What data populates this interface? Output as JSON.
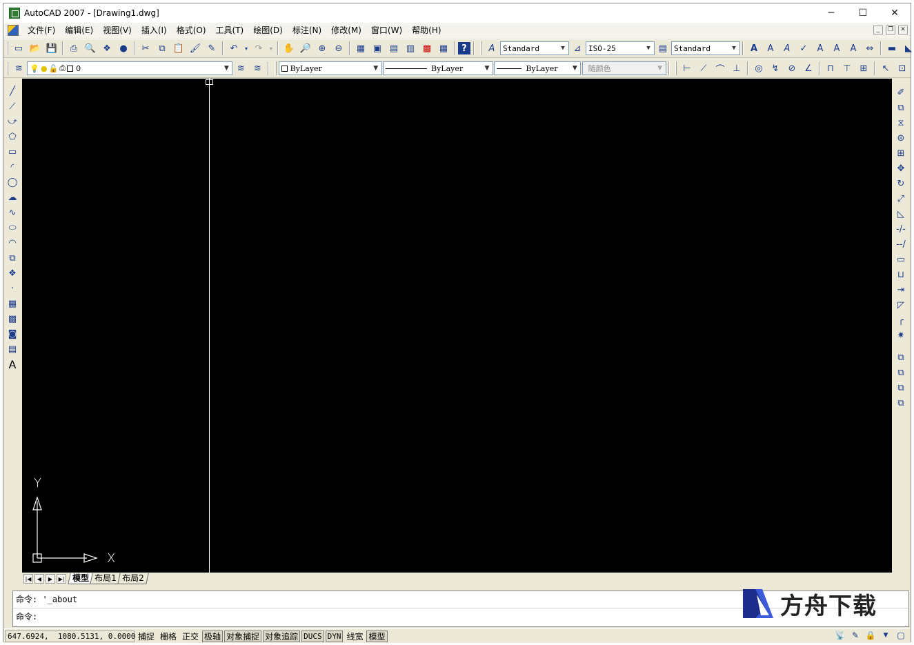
{
  "window": {
    "title": "AutoCAD 2007 - [Drawing1.dwg]",
    "minimize": "─",
    "maximize": "☐",
    "close": "✕"
  },
  "menu": {
    "items": [
      "文件(F)",
      "编辑(E)",
      "视图(V)",
      "插入(I)",
      "格式(O)",
      "工具(T)",
      "绘图(D)",
      "标注(N)",
      "修改(M)",
      "窗口(W)",
      "帮助(H)"
    ],
    "mdi_minimize": "_",
    "mdi_restore": "❐",
    "mdi_close": "✕"
  },
  "toolbar_standard": {
    "icons": [
      "new-icon",
      "open-icon",
      "save-icon",
      "plot-icon",
      "plot-preview-icon",
      "publish-icon",
      "3d-dwf-icon",
      "cut-icon",
      "copy-icon",
      "paste-icon",
      "match-properties-icon",
      "block-editor-icon",
      "undo-icon",
      "redo-icon",
      "pan-icon",
      "zoom-realtime-icon",
      "zoom-window-icon",
      "zoom-previous-icon",
      "properties-icon",
      "design-center-icon",
      "tool-palettes-icon",
      "sheet-set-icon",
      "markup-icon",
      "calculator-icon",
      "help-icon"
    ],
    "text_style_value": "Standard",
    "dim_style_value": "ISO-25",
    "table_style_value": "Standard"
  },
  "toolbar_layers": {
    "layer_value": "0",
    "color_value": "ByLayer",
    "linetype_value": "ByLayer",
    "lineweight_value": "ByLayer",
    "plotstyle_value": "随颜色"
  },
  "canvas": {
    "background": "#000000",
    "ucs_x_label": "X",
    "ucs_y_label": "Y"
  },
  "layout_tabs": {
    "tabs": [
      "模型",
      "布局1",
      "布局2"
    ],
    "active": "模型"
  },
  "command": {
    "history_line": "命令: '_about",
    "prompt_line": "命令:"
  },
  "watermark": {
    "text": "方舟下载"
  },
  "statusbar": {
    "coordinates": "647.6924,  1080.5131, 0.0000",
    "buttons": [
      {
        "label": "捕捉",
        "pressed": false
      },
      {
        "label": "栅格",
        "pressed": false
      },
      {
        "label": "正交",
        "pressed": false
      },
      {
        "label": "极轴",
        "pressed": true
      },
      {
        "label": "对象捕捉",
        "pressed": true
      },
      {
        "label": "对象追踪",
        "pressed": true
      },
      {
        "label": "DUCS",
        "pressed": true
      },
      {
        "label": "DYN",
        "pressed": true
      },
      {
        "label": "线宽",
        "pressed": false
      },
      {
        "label": "模型",
        "pressed": true
      }
    ]
  }
}
